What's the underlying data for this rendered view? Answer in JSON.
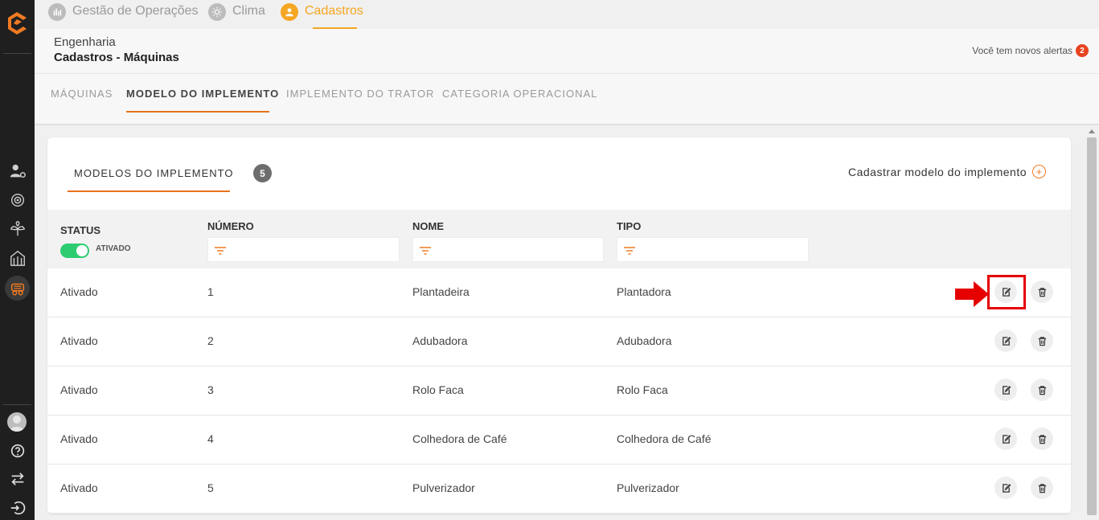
{
  "top_tabs": [
    {
      "label": "Gestão de Operações",
      "icon": "operations-icon"
    },
    {
      "label": "Clima",
      "icon": "sun-icon"
    },
    {
      "label": "Cadastros",
      "icon": "user-icon",
      "active": true
    }
  ],
  "header": {
    "section": "Engenharia",
    "title": "Cadastros - Máquinas",
    "alerts_text": "Você tem novos alertas",
    "alerts_count": "2"
  },
  "sub_tabs": [
    {
      "label": "MÁQUINAS"
    },
    {
      "label": "MODELO DO IMPLEMENTO",
      "active": true
    },
    {
      "label": "IMPLEMENTO DO TRATOR"
    },
    {
      "label": "CATEGORIA OPERACIONAL"
    }
  ],
  "card": {
    "tab_label": "MODELOS DO IMPLEMENTO",
    "count": "5",
    "register_label": "Cadastrar modelo do implemento"
  },
  "table": {
    "columns": {
      "status": "STATUS",
      "numero": "NÚMERO",
      "nome": "NOME",
      "tipo": "TIPO"
    },
    "status_toggle_label": "ATIVADO",
    "rows": [
      {
        "status": "Ativado",
        "numero": "1",
        "nome": "Plantadeira",
        "tipo": "Plantadora"
      },
      {
        "status": "Ativado",
        "numero": "2",
        "nome": "Adubadora",
        "tipo": "Adubadora"
      },
      {
        "status": "Ativado",
        "numero": "3",
        "nome": "Rolo Faca",
        "tipo": "Rolo Faca"
      },
      {
        "status": "Ativado",
        "numero": "4",
        "nome": "Colhedora de Café",
        "tipo": "Colhedora de Café"
      },
      {
        "status": "Ativado",
        "numero": "5",
        "nome": "Pulverizador",
        "tipo": "Pulverizador"
      }
    ]
  },
  "colors": {
    "accent": "#f5a623",
    "underline": "#e8721c",
    "toggle_on": "#2ecc71",
    "highlight": "#e60000",
    "sidebar": "#1f1f1f"
  }
}
